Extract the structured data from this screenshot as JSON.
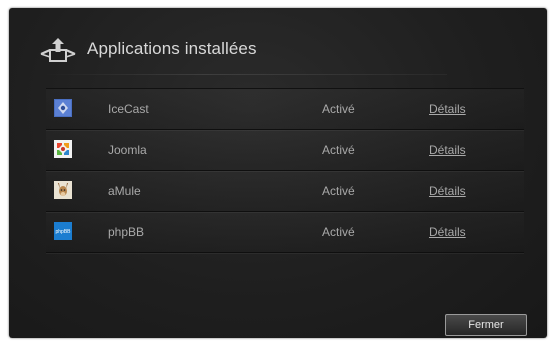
{
  "dialog": {
    "title": "Applications installées",
    "header_icon": "apps-install-icon"
  },
  "apps": [
    {
      "name": "IceCast",
      "status": "Activé",
      "details_label": "Détails",
      "icon": "icecast-icon"
    },
    {
      "name": "Joomla",
      "status": "Activé",
      "details_label": "Détails",
      "icon": "joomla-icon"
    },
    {
      "name": "aMule",
      "status": "Activé",
      "details_label": "Détails",
      "icon": "amule-icon"
    },
    {
      "name": "phpBB",
      "status": "Activé",
      "details_label": "Détails",
      "icon": "phpbb-icon",
      "icon_text": "phpBB"
    }
  ],
  "footer": {
    "close_label": "Fermer"
  },
  "colors": {
    "background": "#1f1f1f",
    "text": "#a9a9a9",
    "title": "#d8d8d8"
  }
}
